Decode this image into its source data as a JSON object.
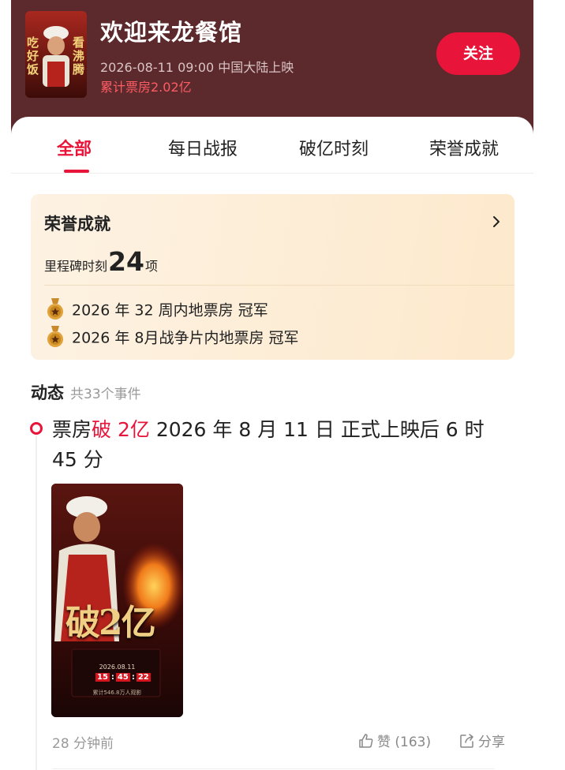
{
  "movie": {
    "title": "欢迎来龙餐馆",
    "release": "2026-08-11 09:00 中国大陆上映",
    "box_office": "累计票房2.02亿",
    "follow_label": "关注",
    "poster_text_left": "吃好饭",
    "poster_text_right": "看沸腾"
  },
  "tabs": [
    {
      "label": "全部",
      "active": true
    },
    {
      "label": "每日战报",
      "active": false
    },
    {
      "label": "破亿时刻",
      "active": false
    },
    {
      "label": "荣誉成就",
      "active": false
    }
  ],
  "honors": {
    "title": "荣誉成就",
    "milestone_label": "里程碑时刻",
    "milestone_count": "24",
    "milestone_unit": "项",
    "awards": [
      {
        "text": "2026 年 32 周内地票房 冠军"
      },
      {
        "text": "2026 年 8月战争片内地票房 冠军"
      }
    ]
  },
  "feed": {
    "title": "动态",
    "count_text": "共33个事件",
    "event": {
      "prefix": "票房",
      "highlight": "破 2亿",
      "rest": " 2026 年 8 月 11 日 正式上映后 6 时 45 分",
      "time_ago": "28 分钟前",
      "like_label": "赞 (163)",
      "share_label": "分享",
      "poster": {
        "big_text": "破2亿",
        "date": "2026.08.11",
        "clock": [
          "15",
          "45",
          "22"
        ],
        "foot": "累计546.8万人观影"
      }
    }
  },
  "colors": {
    "header_bg": "#5c2a2d",
    "accent": "#e8143a",
    "honor_card": "#fde9cc"
  }
}
